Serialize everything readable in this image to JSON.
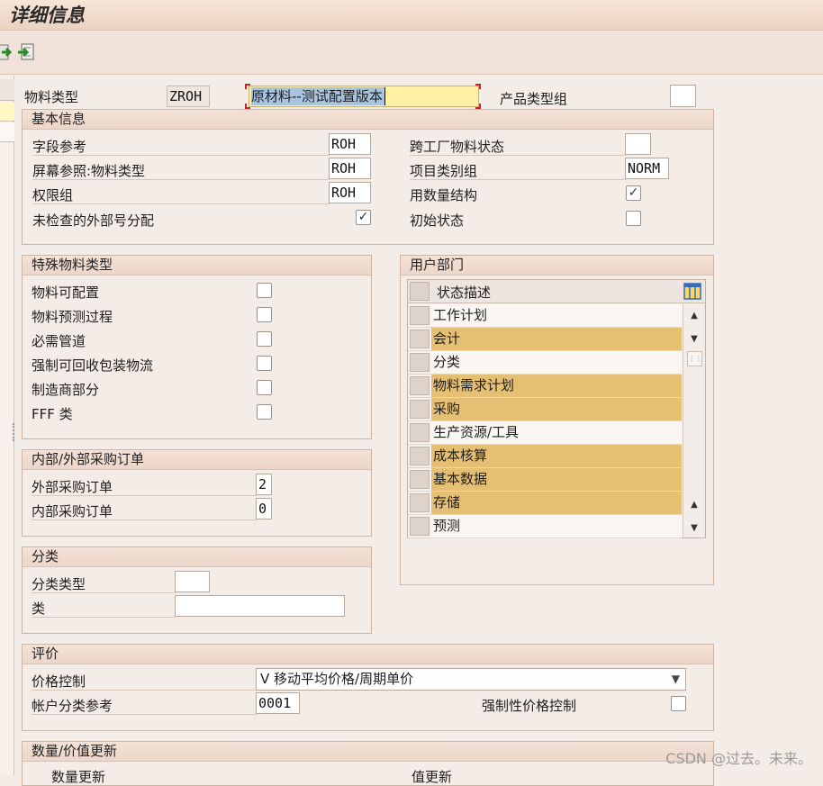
{
  "window": {
    "title": "详细信息"
  },
  "toolbar": {
    "icon1": "arrow-right-icon",
    "icon2": "import-icon"
  },
  "header": {
    "material_type_label": "物料类型",
    "material_type_value": "ZROH",
    "material_type_desc": "原材料--测试配置版本",
    "product_type_group_label": "产品类型组",
    "product_type_group_value": ""
  },
  "basic_info": {
    "title": "基本信息",
    "field_ref_label": "字段参考",
    "field_ref_value": "ROH",
    "screen_ref_label": "屏幕参照:物料类型",
    "screen_ref_value": "ROH",
    "auth_group_label": "权限组",
    "auth_group_value": "ROH",
    "unchecked_ext_label": "未检查的外部号分配",
    "unchecked_ext_checked": true,
    "cross_plant_label": "跨工厂物料状态",
    "cross_plant_value": "",
    "item_cat_label": "项目类别组",
    "item_cat_value": "NORM",
    "qty_struct_label": "用数量结构",
    "qty_struct_checked": true,
    "initial_status_label": "初始状态",
    "initial_status_checked": false
  },
  "special": {
    "title": "特殊物料类型",
    "items": [
      {
        "label": "物料可配置",
        "checked": false
      },
      {
        "label": "物料预测过程",
        "checked": false
      },
      {
        "label": "必需管道",
        "checked": false
      },
      {
        "label": "强制可回收包装物流",
        "checked": false
      },
      {
        "label": "制造商部分",
        "checked": false
      },
      {
        "label": "FFF 类",
        "checked": false
      }
    ]
  },
  "user_dept": {
    "title": "用户部门",
    "column": "状态描述",
    "rows": [
      {
        "label": "工作计划",
        "selected": false
      },
      {
        "label": "会计",
        "selected": true
      },
      {
        "label": "分类",
        "selected": false
      },
      {
        "label": "物料需求计划",
        "selected": true
      },
      {
        "label": "采购",
        "selected": true
      },
      {
        "label": "生产资源/工具",
        "selected": false
      },
      {
        "label": "成本核算",
        "selected": true
      },
      {
        "label": "基本数据",
        "selected": true
      },
      {
        "label": "存储",
        "selected": true
      },
      {
        "label": "预测",
        "selected": false
      }
    ]
  },
  "po": {
    "title": "内部/外部采购订单",
    "ext_label": "外部采购订单",
    "ext_value": "2",
    "int_label": "内部采购订单",
    "int_value": "0"
  },
  "classification": {
    "title": "分类",
    "type_label": "分类类型",
    "type_value": "",
    "class_label": "类",
    "class_value": ""
  },
  "valuation": {
    "title": "评价",
    "price_ctrl_label": "价格控制",
    "price_ctrl_value": "V 移动平均价格/周期单价",
    "acct_cat_label": "帐户分类参考",
    "acct_cat_value": "0001",
    "mandatory_label": "强制性价格控制",
    "mandatory_checked": false
  },
  "qty_value": {
    "title": "数量/价值更新",
    "qty_update_label": "数量更新",
    "value_update_label": "值更新"
  },
  "watermark": "CSDN @过去。未来。",
  "colors": {
    "highlight": "#e4bf74",
    "background": "#f4ece6",
    "group_border": "#cfb4a1"
  }
}
